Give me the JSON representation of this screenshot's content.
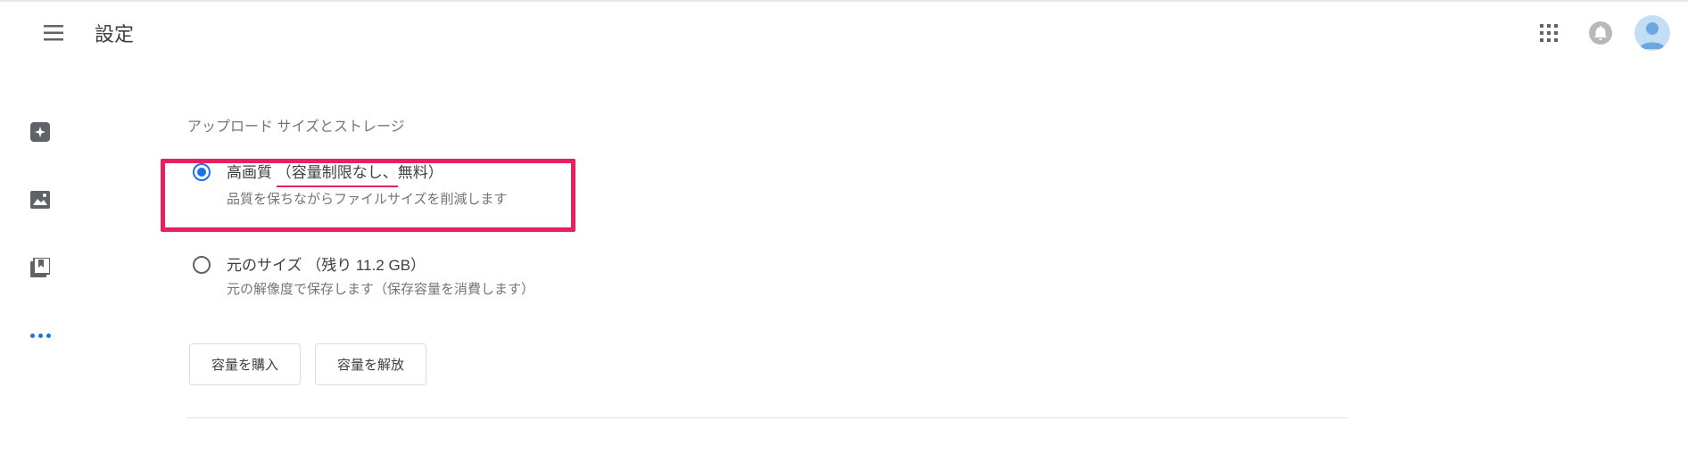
{
  "header": {
    "title": "設定"
  },
  "section": {
    "label": "アップロード サイズとストレージ"
  },
  "options": {
    "high_quality": {
      "title_part1": "高画質",
      "title_part2": "（容量制限なし、",
      "title_part3": "無料）",
      "desc": "品質を保ちながらファイルサイズを削減します"
    },
    "original": {
      "title": "元のサイズ （残り 11.2 GB）",
      "desc": "元の解像度で保存します（保存容量を消費します）"
    }
  },
  "buttons": {
    "buy_storage": "容量を購入",
    "free_storage": "容量を解放"
  }
}
